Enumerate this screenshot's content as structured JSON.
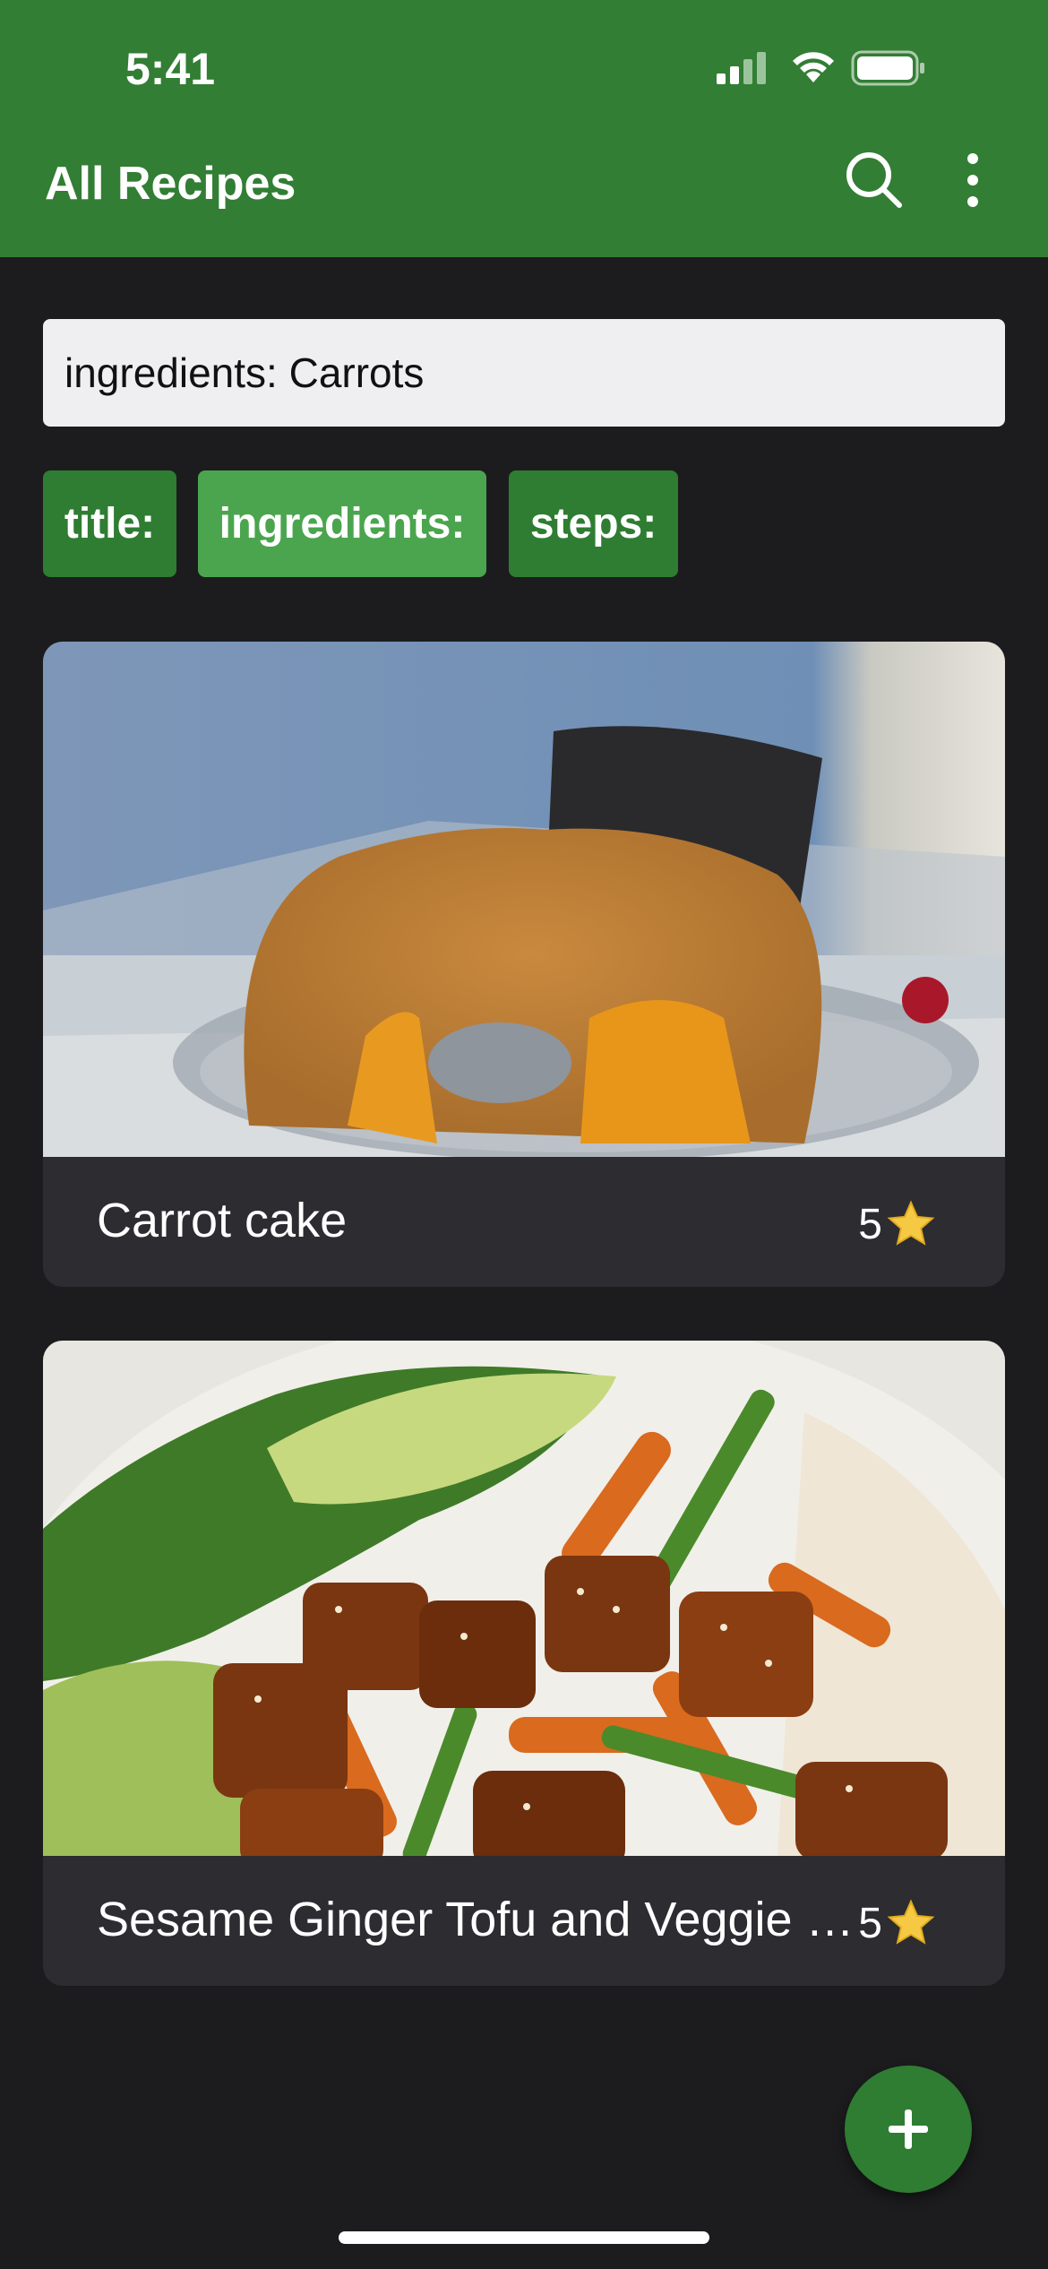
{
  "status_bar": {
    "time": "5:41"
  },
  "app_bar": {
    "title": "All Recipes",
    "search_icon": "search-icon",
    "more_icon": "more-vert-icon"
  },
  "search": {
    "value": "ingredients: Carrots"
  },
  "filter_chips": [
    {
      "label": "title:",
      "selected": false
    },
    {
      "label": "ingredients:",
      "selected": true
    },
    {
      "label": "steps:",
      "selected": false
    }
  ],
  "recipes": [
    {
      "title": "Carrot cake",
      "rating": "5",
      "image": "carrot-bundt-cake-photo"
    },
    {
      "title": "Sesame Ginger Tofu and Veggie Stir Fry",
      "rating": "5",
      "image": "tofu-veggie-bowl-photo"
    }
  ],
  "fab": {
    "icon": "add-icon"
  },
  "colors": {
    "primary": "#327e34",
    "chip_selected": "#4aa54e",
    "background": "#1c1c1e",
    "card": "#2c2c31"
  }
}
